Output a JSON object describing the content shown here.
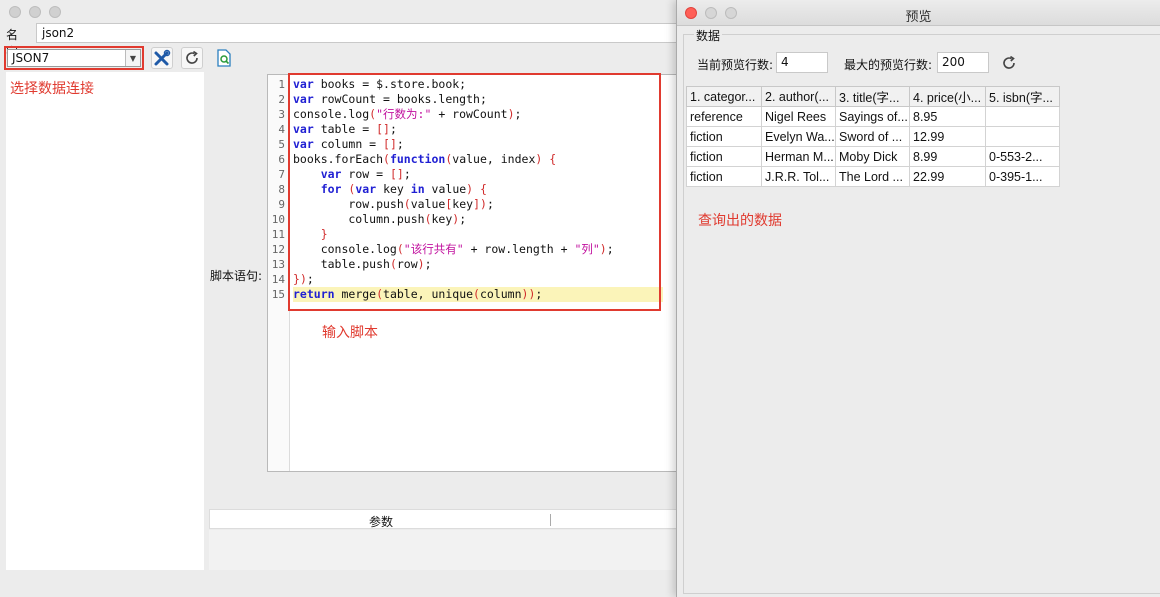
{
  "main": {
    "name_label": "名字:",
    "name_value": "json2",
    "connection_selected": "JSON7",
    "hint_connection": "选择数据连接",
    "script_label": "脚本语句:",
    "hint_script": "输入脚本",
    "params_header": "参数",
    "line_numbers": [
      "1",
      "2",
      "3",
      "4",
      "5",
      "6",
      "7",
      "8",
      "9",
      "10",
      "11",
      "12",
      "13",
      "14",
      "15"
    ],
    "code_lines": [
      "var books = $.store.book;",
      "var rowCount = books.length;",
      "console.log(\"行数为:\" + rowCount);",
      "var table = [];",
      "var column = [];",
      "books.forEach(function(value, index) {",
      "    var row = [];",
      "    for (var key in value) {",
      "        row.push(value[key]);",
      "        column.push(key);",
      "    }",
      "    console.log(\"该行共有\" + row.length + \"列\");",
      "    table.push(row);",
      "});",
      "return merge(table, unique(column));"
    ]
  },
  "preview": {
    "title": "预览",
    "group_label": "数据",
    "current_rows_label": "当前预览行数:",
    "current_rows_value": "4",
    "max_rows_label": "最大的预览行数:",
    "max_rows_value": "200",
    "hint_data": "查询出的数据",
    "columns": [
      "1. categor...",
      "2. author(...",
      "3. title(字...",
      "4. price(小...",
      "5. isbn(字..."
    ],
    "rows": [
      [
        "reference",
        "Nigel Rees",
        "Sayings of...",
        "8.95",
        ""
      ],
      [
        "fiction",
        "Evelyn Wa...",
        "Sword of ...",
        "12.99",
        ""
      ],
      [
        "fiction",
        "Herman M...",
        "Moby Dick",
        "8.99",
        "0-553-2..."
      ],
      [
        "fiction",
        "J.R.R. Tol...",
        "The Lord ...",
        "22.99",
        "0-395-1..."
      ]
    ]
  },
  "colors": {
    "annotation": "#e03a2f",
    "keyword": "#1f1fd3",
    "string": "#c1119e",
    "current_line": "#fbf4b9"
  },
  "icons": [
    "wrench-screwdriver-icon",
    "refresh-icon",
    "document-search-icon",
    "refresh-icon"
  ]
}
